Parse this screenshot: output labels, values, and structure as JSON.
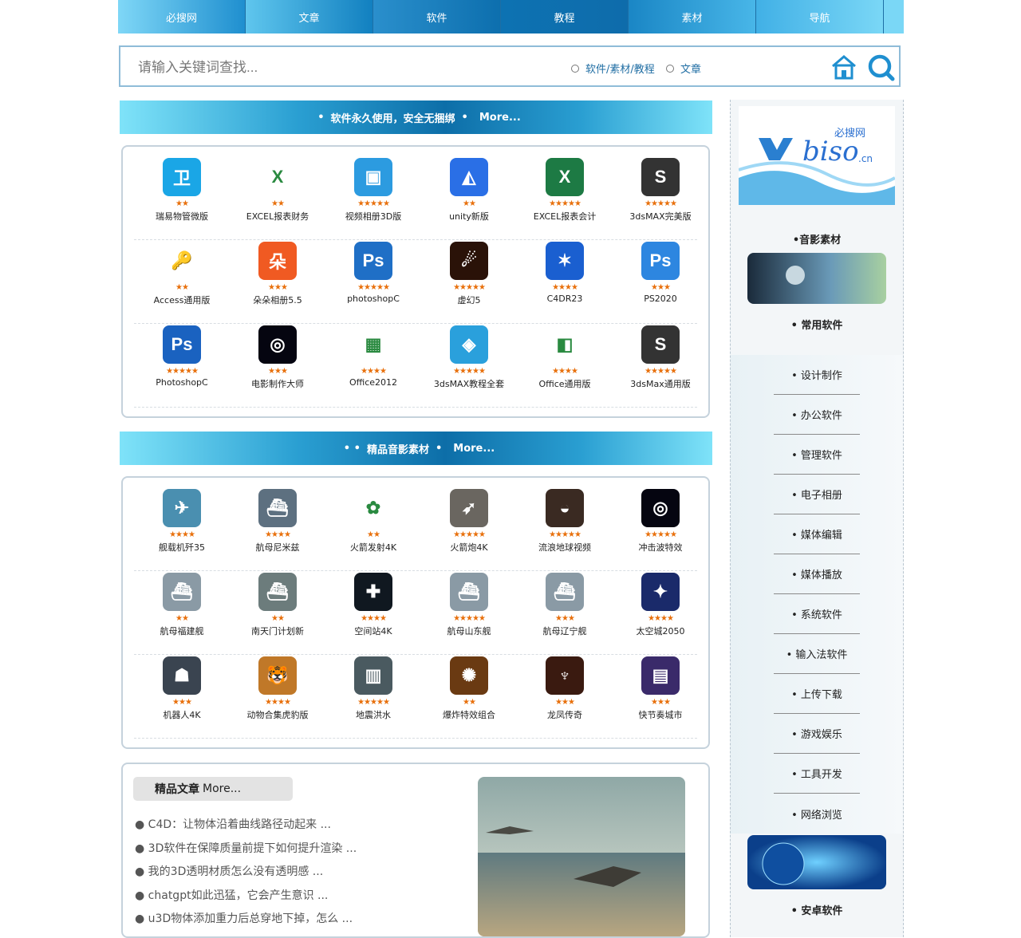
{
  "nav": [
    "必搜网",
    "文章",
    "软件",
    "教程",
    "素材",
    "导航"
  ],
  "search": {
    "placeholder": "请输入关键词查找...",
    "option1": "软件/素材/教程",
    "option2": "文章"
  },
  "software": {
    "header_bullet": "•",
    "header_title": "软件永久使用，安全无捆绑",
    "more": "More...",
    "items": [
      {
        "name": "瑞易物管微版",
        "stars": "★★",
        "icon": "ruiyi-icon",
        "color": "#1aa6e6",
        "glyph": "卫"
      },
      {
        "name": "EXCEL报表财务",
        "stars": "★★",
        "icon": "excel-icon",
        "color": "#ffffff",
        "glyph": "X"
      },
      {
        "name": "视频相册3D版",
        "stars": "★★★★★",
        "icon": "3d-cube-icon",
        "color": "#2c9be0",
        "glyph": "▣"
      },
      {
        "name": "unity新版",
        "stars": "★★",
        "icon": "unity-icon",
        "color": "#2a6fe6",
        "glyph": "◭"
      },
      {
        "name": "EXCEL报表会计",
        "stars": "★★★★★",
        "icon": "excel-green-icon",
        "color": "#1d7a44",
        "glyph": "X"
      },
      {
        "name": "3dsMAX完美版",
        "stars": "★★★★★",
        "icon": "3dsmax-icon",
        "color": "#333333",
        "glyph": "S"
      },
      {
        "name": "Access通用版",
        "stars": "★★",
        "icon": "access-key-icon",
        "color": "#ffffff",
        "glyph": "🔑"
      },
      {
        "name": "朵朵相册5.5",
        "stars": "★★★",
        "icon": "duoduo-icon",
        "color": "#f05a22",
        "glyph": "朵"
      },
      {
        "name": "photoshopC",
        "stars": "★★★★★",
        "icon": "photoshop-icon",
        "color": "#1f6fc6",
        "glyph": "Ps"
      },
      {
        "name": "虚幻5",
        "stars": "★★★★★",
        "icon": "unreal-meteor-icon",
        "color": "#2a1208",
        "glyph": "☄"
      },
      {
        "name": "C4DR23",
        "stars": "★★★★",
        "icon": "c4d-icon",
        "color": "#1a5fd0",
        "glyph": "✶"
      },
      {
        "name": "PS2020",
        "stars": "★★★",
        "icon": "ps2020-icon",
        "color": "#2d86e0",
        "glyph": "Ps"
      },
      {
        "name": "PhotoshopC",
        "stars": "★★★★★",
        "icon": "photoshop-cc-icon",
        "color": "#1a62c0",
        "glyph": "Ps"
      },
      {
        "name": "电影制作大师",
        "stars": "★★★",
        "icon": "movie-maker-icon",
        "color": "#050510",
        "glyph": "◎"
      },
      {
        "name": "Office2012",
        "stars": "★★★★",
        "icon": "office2012-icon",
        "color": "#ffffff",
        "glyph": "▦"
      },
      {
        "name": "3dsMAX教程全套",
        "stars": "★★★★★",
        "icon": "3dsmax-cubes-icon",
        "color": "#2aa0dc",
        "glyph": "◈"
      },
      {
        "name": "Office通用版",
        "stars": "★★★★",
        "icon": "office-icon",
        "color": "#ffffff",
        "glyph": "◧"
      },
      {
        "name": "3dsMax通用版",
        "stars": "★★★★★",
        "icon": "3dsmax-generic-icon",
        "color": "#333333",
        "glyph": "S"
      }
    ]
  },
  "media": {
    "header_bullet": "• •",
    "header_title": "精品音影素材",
    "more": "More...",
    "items": [
      {
        "name": "舰载机歼35",
        "stars": "★★★★",
        "icon": "jet-fighter-icon",
        "color": "#4a8fb0",
        "glyph": "✈"
      },
      {
        "name": "航母尼米兹",
        "stars": "★★★★",
        "icon": "carrier-nimitz-icon",
        "color": "#5d7080",
        "glyph": "⛴"
      },
      {
        "name": "火箭发射4K",
        "stars": "★★",
        "icon": "flower-icon",
        "color": "#ffffff",
        "glyph": "✿"
      },
      {
        "name": "火箭炮4K",
        "stars": "★★★★★",
        "icon": "rocket-artillery-icon",
        "color": "#6a6660",
        "glyph": "➶"
      },
      {
        "name": "流浪地球视频",
        "stars": "★★★★★",
        "icon": "wandering-earth-icon",
        "color": "#3a2a22",
        "glyph": "◒"
      },
      {
        "name": "冲击波特效",
        "stars": "★★★★★",
        "icon": "shockwave-icon",
        "color": "#050510",
        "glyph": "◎"
      },
      {
        "name": "航母福建舰",
        "stars": "★★",
        "icon": "carrier-fujian-icon",
        "color": "#8a9aa5",
        "glyph": "⛴"
      },
      {
        "name": "南天门计划新",
        "stars": "★★",
        "icon": "nantianmen-icon",
        "color": "#6c7c7c",
        "glyph": "⛴"
      },
      {
        "name": "空间站4K",
        "stars": "★★★★",
        "icon": "space-station-icon",
        "color": "#101820",
        "glyph": "✚"
      },
      {
        "name": "航母山东舰",
        "stars": "★★★★★",
        "icon": "carrier-shandong-icon",
        "color": "#8a9aa5",
        "glyph": "⛴"
      },
      {
        "name": "航母辽宁舰",
        "stars": "★★★",
        "icon": "carrier-liaoning-icon",
        "color": "#8a9aa5",
        "glyph": "⛴"
      },
      {
        "name": "太空城2050",
        "stars": "★★★★",
        "icon": "space-city-icon",
        "color": "#1a2a6a",
        "glyph": "✦"
      },
      {
        "name": "机器人4K",
        "stars": "★★★",
        "icon": "robot-icon",
        "color": "#3a4450",
        "glyph": "☗"
      },
      {
        "name": "动物合集虎豹版",
        "stars": "★★★★",
        "icon": "tiger-icon",
        "color": "#c07828",
        "glyph": "🐯"
      },
      {
        "name": "地震洪水",
        "stars": "★★★★★",
        "icon": "flood-icon",
        "color": "#4a5a60",
        "glyph": "▥"
      },
      {
        "name": "爆炸特效组合",
        "stars": "★★",
        "icon": "explosion-icon",
        "color": "#6a3a12",
        "glyph": "✺"
      },
      {
        "name": "龙凤传奇",
        "stars": "★★★",
        "icon": "dragon-phoenix-icon",
        "color": "#3a1a10",
        "glyph": "♆"
      },
      {
        "name": "快节奏城市",
        "stars": "★★★",
        "icon": "city-traffic-icon",
        "color": "#3a2a6a",
        "glyph": "▤"
      }
    ]
  },
  "articles": {
    "title": "精品文章",
    "more": "More...",
    "items": [
      "● C4D：让物体沿着曲线路径动起来 ...",
      "● 3D软件在保障质量前提下如何提升渲染 ...",
      "● 我的3D透明材质怎么没有透明感 ...",
      "● chatgpt如此迅猛，它会产生意识 ...",
      "● u3D物体添加重力后总穿地下掉，怎么 ..."
    ]
  },
  "sidebar": {
    "logo_text": "必搜网",
    "logo_brand": "biso",
    "logo_tld": ".cn",
    "media_title": "•音影素材",
    "common_title": "• 常用软件",
    "links": [
      "• 设计制作",
      "• 办公软件",
      "• 管理软件",
      "• 电子相册",
      "• 媒体编辑",
      "• 媒体播放",
      "• 系统软件",
      "• 输入法软件",
      "• 上传下载",
      "• 游戏娱乐",
      "• 工具开发",
      "• 网络浏览"
    ],
    "android_title": "• 安卓软件"
  },
  "colors": {
    "accent": "#0d6ea8",
    "stars": "#e8700c",
    "link": "#1f6da3"
  }
}
